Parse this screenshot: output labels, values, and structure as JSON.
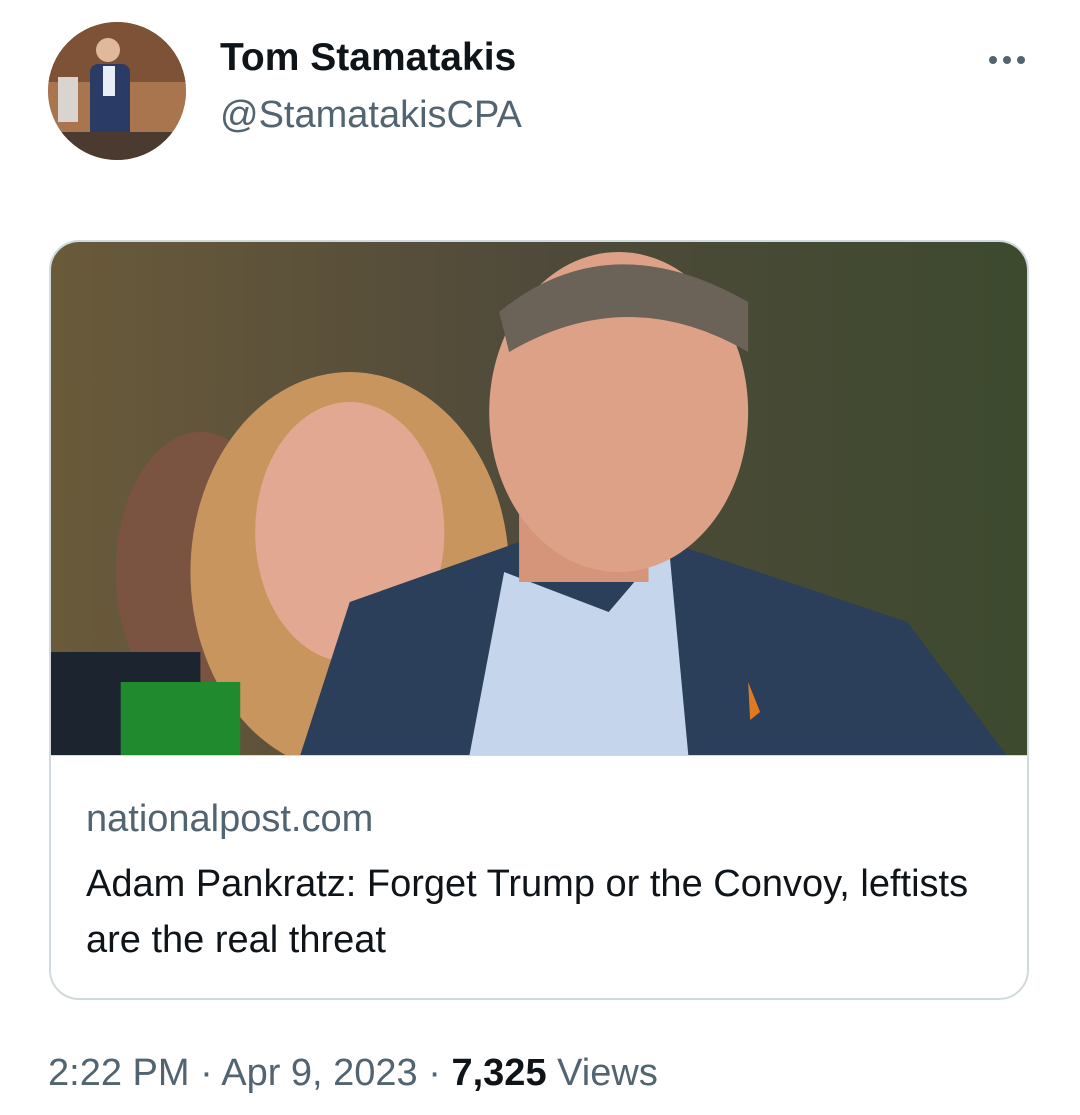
{
  "author": {
    "display_name": "Tom Stamatakis",
    "handle": "@StamatakisCPA",
    "avatar_icon": "profile-photo"
  },
  "more_icon": "more-horizontal-icon",
  "link_card": {
    "image_description_icon": "news-photo",
    "domain": "nationalpost.com",
    "headline": "Adam Pankratz: Forget Trump or the Convoy, leftists are the real threat"
  },
  "meta": {
    "time": "2:22 PM",
    "separator": "·",
    "date": "Apr 9, 2023",
    "views_count": "7,325",
    "views_label": "Views"
  },
  "colors": {
    "text_primary": "#0f1419",
    "text_secondary": "#536471",
    "border": "#cfd9de"
  }
}
